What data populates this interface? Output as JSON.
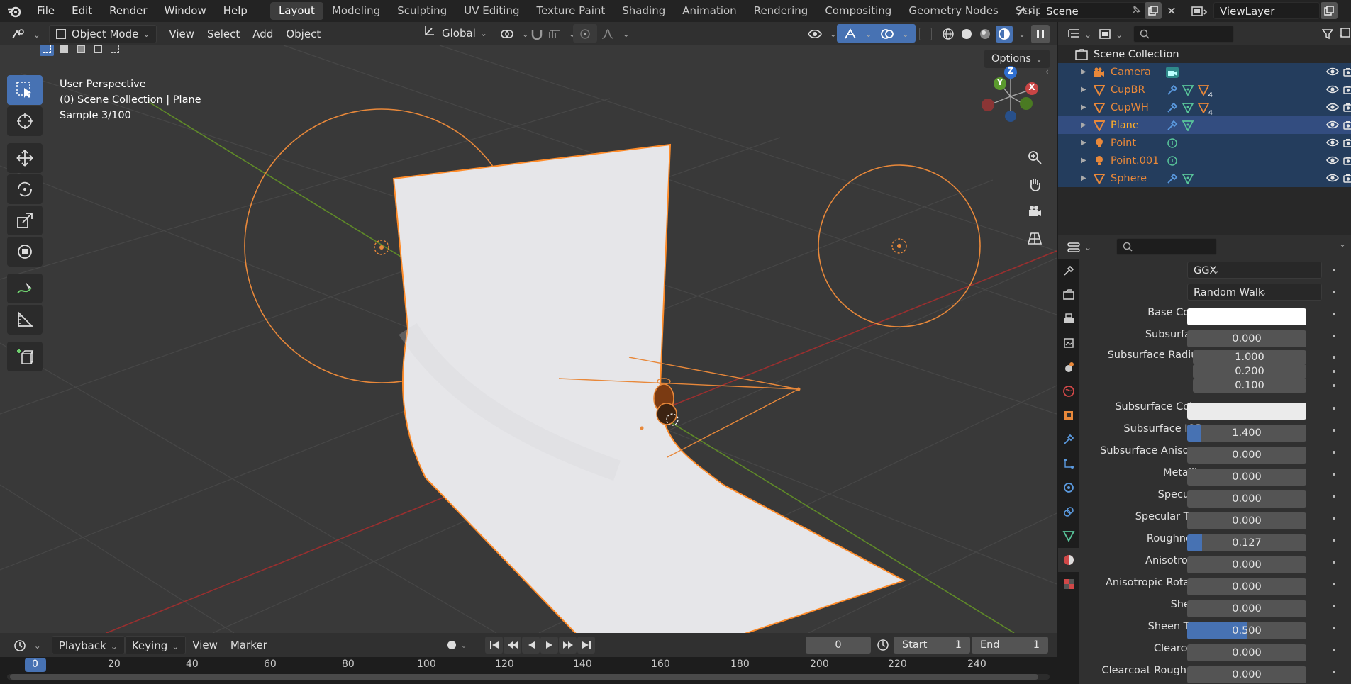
{
  "menu": [
    "File",
    "Edit",
    "Render",
    "Window",
    "Help"
  ],
  "workspaces": [
    "Layout",
    "Modeling",
    "Sculpting",
    "UV Editing",
    "Texture Paint",
    "Shading",
    "Animation",
    "Rendering",
    "Compositing",
    "Geometry Nodes",
    "Scripting"
  ],
  "active_workspace": "Layout",
  "scene_name": "Scene",
  "view_layer": "ViewLayer",
  "viewport_header": {
    "mode": "Object Mode",
    "menus": [
      "View",
      "Select",
      "Add",
      "Object"
    ],
    "transform_orientation": "Global",
    "options": "Options"
  },
  "viewport_info": {
    "line1": "User Perspective",
    "line2": "(0) Scene Collection | Plane",
    "line3": "Sample 3/100"
  },
  "gizmo_axes": {
    "x": "X",
    "y": "Y",
    "z": "Z"
  },
  "outliner": {
    "root": "Scene Collection",
    "items": [
      {
        "name": "Camera",
        "icon": "camera-icon",
        "badges": [
          "camera-data-icon"
        ]
      },
      {
        "name": "CupBR",
        "icon": "mesh-icon",
        "badges": [
          "wrench-icon",
          "mesh-data-icon",
          "materials-count-icon"
        ],
        "count": "4"
      },
      {
        "name": "CupWH",
        "icon": "mesh-icon",
        "badges": [
          "wrench-icon",
          "mesh-data-icon",
          "materials-count-icon"
        ],
        "count": "4"
      },
      {
        "name": "Plane",
        "icon": "mesh-icon",
        "badges": [
          "wrench-icon",
          "mesh-data-icon"
        ],
        "active": true
      },
      {
        "name": "Point",
        "icon": "light-icon",
        "badges": [
          "light-data-icon"
        ]
      },
      {
        "name": "Point.001",
        "icon": "light-icon",
        "badges": [
          "light-data-icon"
        ]
      },
      {
        "name": "Sphere",
        "icon": "mesh-icon",
        "badges": [
          "wrench-icon",
          "mesh-data-icon"
        ]
      }
    ]
  },
  "properties": {
    "distribution": "GGX",
    "subsurface_method": "Random Walk",
    "rows": [
      {
        "label": "Base Color",
        "type": "color",
        "color": "#ffffff",
        "dot": "yellow"
      },
      {
        "label": "Subsurface",
        "type": "value",
        "value": "0.000",
        "fill": 0
      },
      {
        "label": "Subsurface Radius",
        "type": "vector",
        "values": [
          "1.000",
          "0.200",
          "0.100"
        ],
        "dot": "purple"
      },
      {
        "label": "Subsurface Color",
        "type": "color",
        "color": "#ebebeb",
        "dot": "yellow"
      },
      {
        "label": "Subsurface IOR",
        "type": "value",
        "value": "1.400",
        "fill": 0.12
      },
      {
        "label": "Subsurface Anisot...",
        "type": "value",
        "value": "0.000",
        "fill": 0
      },
      {
        "label": "Metallic",
        "type": "value",
        "value": "0.000",
        "fill": 0
      },
      {
        "label": "Specular",
        "type": "value",
        "value": "0.000",
        "fill": 0
      },
      {
        "label": "Specular Tint",
        "type": "value",
        "value": "0.000",
        "fill": 0
      },
      {
        "label": "Roughness",
        "type": "value",
        "value": "0.127",
        "fill": 0.127
      },
      {
        "label": "Anisotropic",
        "type": "value",
        "value": "0.000",
        "fill": 0
      },
      {
        "label": "Anisotropic Rotatio",
        "type": "value",
        "value": "0.000",
        "fill": 0
      },
      {
        "label": "Sheen",
        "type": "value",
        "value": "0.000",
        "fill": 0
      },
      {
        "label": "Sheen Tint",
        "type": "value",
        "value": "0.500",
        "fill": 0.5
      },
      {
        "label": "Clearcoat",
        "type": "value",
        "value": "0.000",
        "fill": 0
      },
      {
        "label": "Clearcoat Roughn...",
        "type": "value",
        "value": "0.000",
        "fill": 0
      }
    ]
  },
  "timeline": {
    "menus": [
      "Playback",
      "Keying",
      "View",
      "Marker"
    ],
    "current_frame": "0",
    "start_label": "Start",
    "start": "1",
    "end_label": "End",
    "end": "1",
    "ruler": [
      "0",
      "20",
      "40",
      "60",
      "80",
      "100",
      "120",
      "140",
      "160",
      "180",
      "200",
      "220",
      "240"
    ]
  },
  "colors": {
    "accent": "#4772b3",
    "selection": "#e8883a",
    "active_selection": "#ffaf29",
    "x_axis": "#c03a3a",
    "y_axis": "#6f9a30"
  }
}
